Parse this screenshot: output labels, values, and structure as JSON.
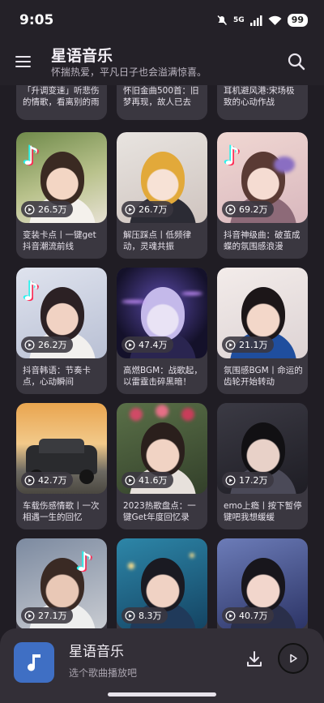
{
  "status": {
    "time": "9:05",
    "network": "5G",
    "battery": "99"
  },
  "header": {
    "title": "星语音乐",
    "subtitle": "怀揣热爱，平凡日子也会溢满惊喜。"
  },
  "colors": {
    "background": "#201d24",
    "card": "#3a3740",
    "accent": "#3f6fc4"
  },
  "cards": [
    {
      "title": "「升调变速」听悲伤的情歌，看离别的雨",
      "plays": ""
    },
    {
      "title": "怀旧金曲500首：旧梦再现，故人已去",
      "plays": ""
    },
    {
      "title": "耳机避风港:宋场极致的心动作战",
      "plays": ""
    },
    {
      "title": "变装卡点丨一键get抖音潮流前线",
      "plays": "26.5万"
    },
    {
      "title": "解压踩点丨低频律动，灵魂共振",
      "plays": "26.7万"
    },
    {
      "title": "抖音神级曲：破茧成蝶的氛围感浪漫",
      "plays": "69.2万"
    },
    {
      "title": "抖音韩语：节奏卡点，心动瞬间",
      "plays": "26.2万"
    },
    {
      "title": "高燃BGM：战歌起，以雷霆击碎黑暗！",
      "plays": "47.4万"
    },
    {
      "title": "氛围感BGM丨命运的齿轮开始转动",
      "plays": "21.1万"
    },
    {
      "title": "车载伤感情歌丨一次相遇一生的回忆",
      "plays": "42.7万"
    },
    {
      "title": "2023热歌盘点：一键Get年度回忆录",
      "plays": "41.6万"
    },
    {
      "title": "emo上瘾丨按下暂停键吧我想缓缓",
      "plays": "17.2万"
    },
    {
      "title": "",
      "plays": "27.1万"
    },
    {
      "title": "",
      "plays": "8.3万"
    },
    {
      "title": "",
      "plays": "40.7万"
    }
  ],
  "player": {
    "title": "星语音乐",
    "subtitle": "选个歌曲播放吧"
  },
  "icons": {
    "menu": "menu-icon",
    "search": "search-icon",
    "play_count": "play-circle-icon",
    "music_note": "music-note-icon",
    "download": "download-icon",
    "play": "play-icon"
  }
}
